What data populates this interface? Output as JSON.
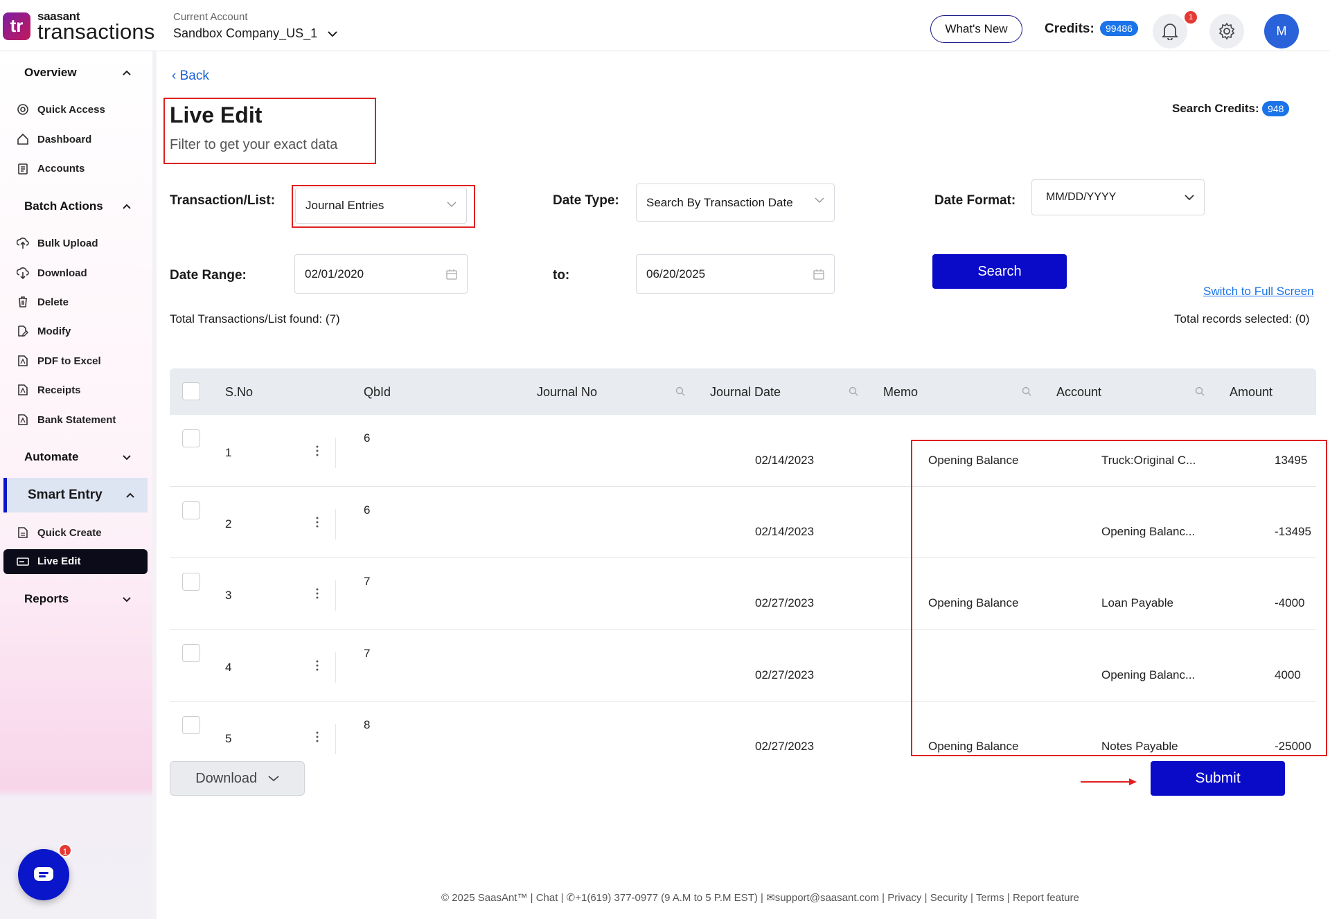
{
  "brand": {
    "logo_mark": "tr",
    "logo_small": "saasant",
    "logo_big": "transactions"
  },
  "header": {
    "account_label": "Current Account",
    "account_name": "Sandbox Company_US_1",
    "whats_new": "What's New",
    "credits_label": "Credits:",
    "credits_value": "99486",
    "notification_count": "1",
    "avatar_initial": "M"
  },
  "sidebar": {
    "overview": "Overview",
    "overview_items": [
      "Quick Access",
      "Dashboard",
      "Accounts"
    ],
    "batch_actions": "Batch Actions",
    "batch_items": [
      "Bulk Upload",
      "Download",
      "Delete",
      "Modify",
      "PDF to Excel",
      "Receipts",
      "Bank Statement"
    ],
    "automate": "Automate",
    "smart_entry": "Smart Entry",
    "smart_items": [
      "Quick Create",
      "Live Edit"
    ],
    "reports": "Reports",
    "chat_badge": "1"
  },
  "main": {
    "back": "Back",
    "title": "Live Edit",
    "subtitle": "Filter to get your exact data",
    "search_credits_label": "Search Credits:",
    "search_credits_value": "948",
    "transaction_label": "Transaction/List:",
    "transaction_value": "Journal Entries",
    "date_type_label": "Date Type:",
    "date_type_value": "Search By Transaction Date",
    "date_format_label": "Date Format:",
    "date_format_value": "MM/DD/YYYY",
    "date_range_label": "Date Range:",
    "date_from": "02/01/2020",
    "to_label": "to:",
    "date_to": "06/20/2025",
    "search_button": "Search",
    "full_screen_link": "Switch to Full Screen",
    "total_found": "Total Transactions/List found: (7)",
    "total_selected": "Total records selected: (0)",
    "download_button": "Download",
    "submit_button": "Submit"
  },
  "table": {
    "headers": [
      "S.No",
      "QbId",
      "Journal No",
      "Journal Date",
      "Memo",
      "Account",
      "Amount"
    ],
    "rows": [
      {
        "sno": "1",
        "qbid": "6",
        "journal_no": "",
        "date": "02/14/2023",
        "memo": "Opening Balance",
        "account": "Truck:Original C...",
        "amount": "13495"
      },
      {
        "sno": "2",
        "qbid": "6",
        "journal_no": "",
        "date": "02/14/2023",
        "memo": "",
        "account": "Opening Balanc...",
        "amount": "-13495"
      },
      {
        "sno": "3",
        "qbid": "7",
        "journal_no": "",
        "date": "02/27/2023",
        "memo": "Opening Balance",
        "account": "Loan Payable",
        "amount": "-4000"
      },
      {
        "sno": "4",
        "qbid": "7",
        "journal_no": "",
        "date": "02/27/2023",
        "memo": "",
        "account": "Opening Balanc...",
        "amount": "4000"
      },
      {
        "sno": "5",
        "qbid": "8",
        "journal_no": "",
        "date": "02/27/2023",
        "memo": "Opening Balance",
        "account": "Notes Payable",
        "amount": "-25000"
      }
    ]
  },
  "footer": {
    "copyright": "© 2025 SaasAnt™",
    "chat": "Chat",
    "phone": "+1(619) 377-0977 (9 A.M to 5 P.M EST)",
    "email": "support@saasant.com",
    "privacy": "Privacy",
    "security": "Security",
    "terms": "Terms",
    "report": "Report feature"
  },
  "colors": {
    "primary": "#0a0ac9",
    "badge": "#1a73e8",
    "highlight": "#e02020",
    "alert": "#e53935"
  },
  "icons": [
    "target-icon",
    "home-icon",
    "clipboard-icon",
    "upload-icon",
    "download-icon",
    "trash-icon",
    "modify-icon",
    "pdf-icon",
    "receipt-icon",
    "bank-statement-icon",
    "quick-create-icon",
    "live-edit-icon",
    "bell-icon",
    "gear-icon",
    "calendar-icon",
    "search-icon",
    "chat-icon"
  ]
}
